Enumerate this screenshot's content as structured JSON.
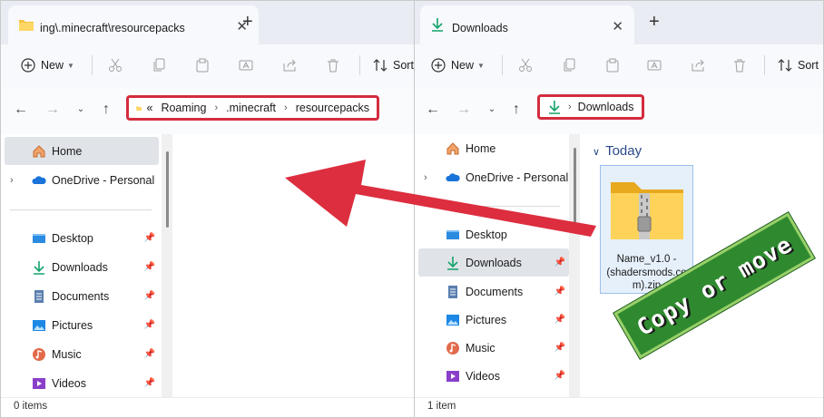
{
  "left_window": {
    "tab_title": "ing\\.minecraft\\resourcepacks",
    "toolbar": {
      "new_label": "New",
      "sort_label": "Sort"
    },
    "breadcrumb": {
      "overflow": "«",
      "items": [
        "Roaming",
        ".minecraft",
        "resourcepacks"
      ]
    },
    "sidebar": {
      "items": [
        {
          "label": "Home"
        },
        {
          "label": "OneDrive - Personal"
        },
        {
          "label": "Desktop"
        },
        {
          "label": "Downloads"
        },
        {
          "label": "Documents"
        },
        {
          "label": "Pictures"
        },
        {
          "label": "Music"
        },
        {
          "label": "Videos"
        }
      ]
    },
    "status": "0 items"
  },
  "right_window": {
    "tab_title": "Downloads",
    "toolbar": {
      "new_label": "New",
      "sort_label": "Sort"
    },
    "breadcrumb": {
      "items": [
        "Downloads"
      ]
    },
    "sidebar": {
      "items": [
        {
          "label": "Home"
        },
        {
          "label": "OneDrive - Personal"
        },
        {
          "label": "Desktop"
        },
        {
          "label": "Downloads"
        },
        {
          "label": "Documents"
        },
        {
          "label": "Pictures"
        },
        {
          "label": "Music"
        },
        {
          "label": "Videos"
        }
      ]
    },
    "group_header": "Today",
    "file": {
      "name": "Name_v1.0 - (shadersmods.com).zip",
      "lines": [
        "Name_v1.0 -",
        "(shadersmods.co",
        "m).zip"
      ]
    },
    "status": "1 item"
  },
  "overlay": {
    "badge_text": "Copy or move",
    "arrow_color": "#dc2e3f",
    "badge_color": "#2f8a2f"
  },
  "colors": {
    "highlight_border": "#d42c3e",
    "selection": "#e0e3e8",
    "accent": "#0067c0"
  }
}
